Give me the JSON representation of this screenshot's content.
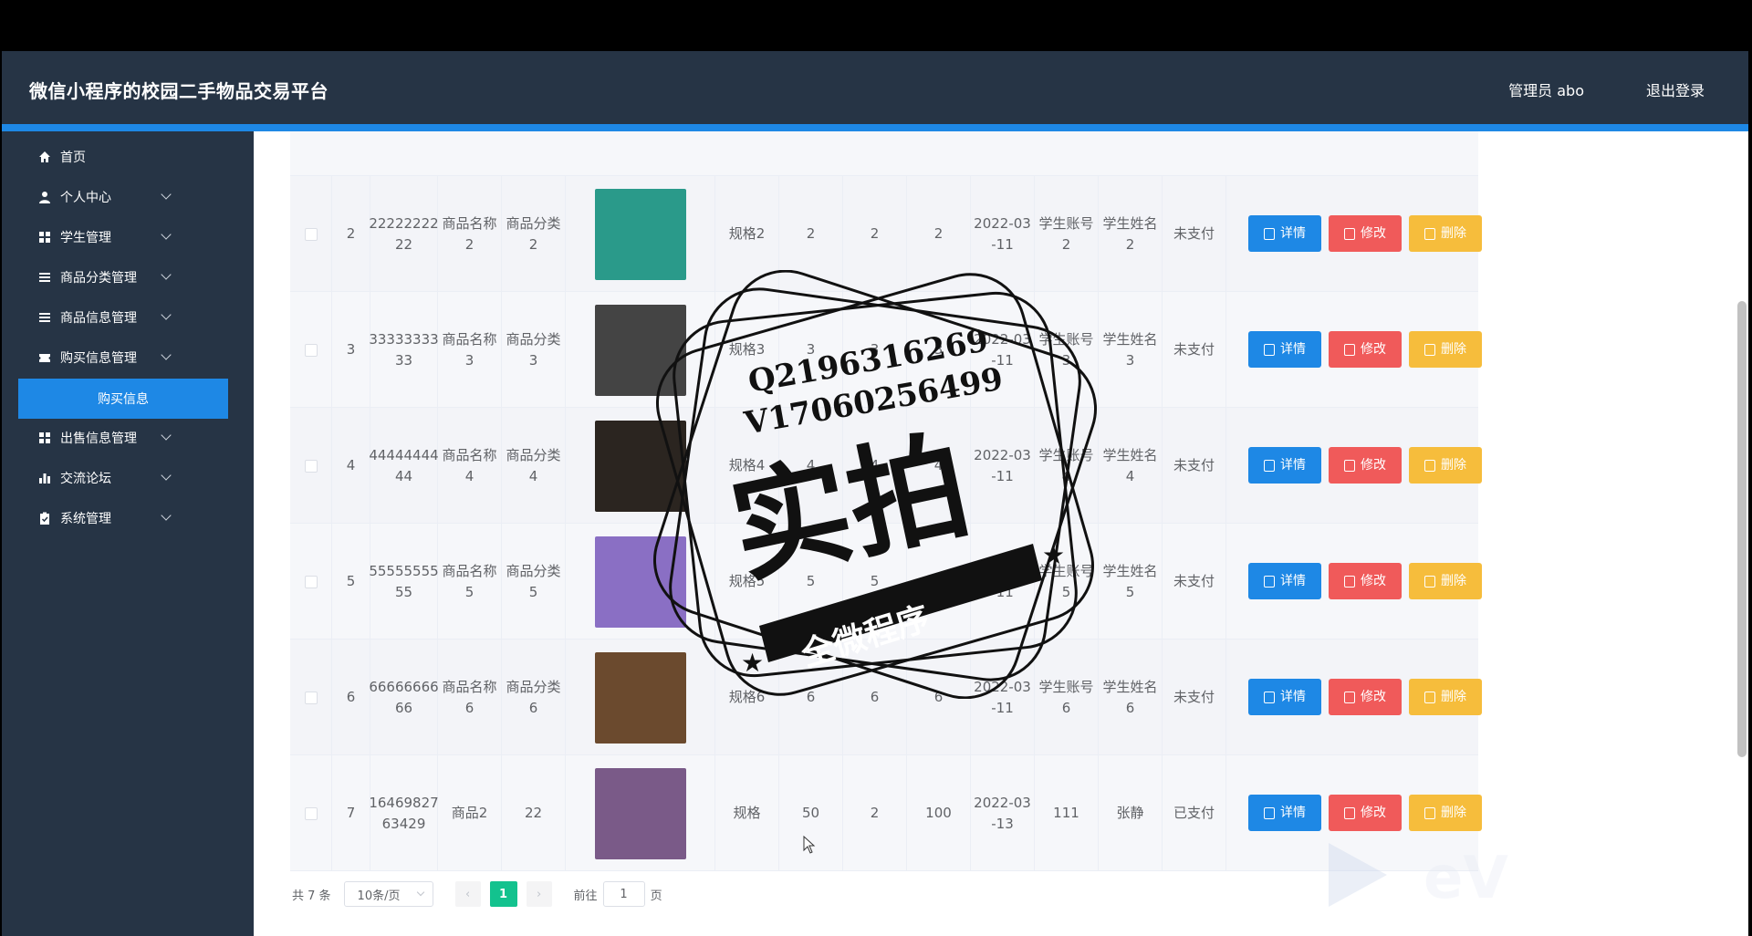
{
  "header": {
    "title": "微信小程序的校园二手物品交易平台",
    "user": "管理员 abo",
    "logout": "退出登录"
  },
  "sidebar": {
    "items": [
      {
        "label": "首页",
        "icon": "home-icon"
      },
      {
        "label": "个人中心",
        "icon": "user-icon"
      },
      {
        "label": "学生管理",
        "icon": "grid-icon"
      },
      {
        "label": "商品分类管理",
        "icon": "list-icon"
      },
      {
        "label": "商品信息管理",
        "icon": "list-icon"
      },
      {
        "label": "购买信息管理",
        "icon": "ticket-icon"
      },
      {
        "label": "出售信息管理",
        "icon": "grid-icon"
      },
      {
        "label": "交流论坛",
        "icon": "chart-icon"
      },
      {
        "label": "系统管理",
        "icon": "clipboard-icon"
      }
    ],
    "active_sub": "购买信息"
  },
  "table": {
    "rows": [
      {
        "index": "2",
        "code": "22222222 22",
        "name": "商品名称 2",
        "category": "商品分类 2",
        "spec": "规格2",
        "price": "2",
        "qty": "2",
        "total": "2",
        "date": "2022-03 -11",
        "account": "学生账号 2",
        "student": "学生姓名 2",
        "status": "未支付",
        "img_color": "#2a9a8a"
      },
      {
        "index": "3",
        "code": "33333333 33",
        "name": "商品名称 3",
        "category": "商品分类 3",
        "spec": "规格3",
        "price": "3",
        "qty": "3",
        "total": "3",
        "date": "2022-03 -11",
        "account": "学生账号 3",
        "student": "学生姓名 3",
        "status": "未支付",
        "img_color": "#444444"
      },
      {
        "index": "4",
        "code": "44444444 44",
        "name": "商品名称 4",
        "category": "商品分类 4",
        "spec": "规格4",
        "price": "4",
        "qty": "4",
        "total": "4",
        "date": "2022-03 -11",
        "account": "学生账号 4",
        "student": "学生姓名 4",
        "status": "未支付",
        "img_color": "#2b2520"
      },
      {
        "index": "5",
        "code": "55555555 55",
        "name": "商品名称 5",
        "category": "商品分类 5",
        "spec": "规格5",
        "price": "5",
        "qty": "5",
        "total": "5",
        "date": "2022-03 -11",
        "account": "学生账号 5",
        "student": "学生姓名 5",
        "status": "未支付",
        "img_color": "#8a6fc4"
      },
      {
        "index": "6",
        "code": "66666666 66",
        "name": "商品名称 6",
        "category": "商品分类 6",
        "spec": "规格6",
        "price": "6",
        "qty": "6",
        "total": "6",
        "date": "2022-03 -11",
        "account": "学生账号 6",
        "student": "学生姓名 6",
        "status": "未支付",
        "img_color": "#6b4a2e"
      },
      {
        "index": "7",
        "code": "16469827 63429",
        "name": "商品2",
        "category": "22",
        "spec": "规格",
        "price": "50",
        "qty": "2",
        "total": "100",
        "date": "2022-03 -13",
        "account": "111",
        "student": "张静",
        "status": "已支付",
        "img_color": "#7a5a88"
      }
    ],
    "actions": {
      "detail": "详情",
      "edit": "修改",
      "delete": "删除"
    }
  },
  "pagination": {
    "total": "共 7 条",
    "page_size": "10条/页",
    "current": "1",
    "goto_prefix": "前往",
    "goto_value": "1",
    "goto_suffix": "页"
  },
  "watermark": {
    "line1": "Q2196316269",
    "line2": "V17060256499",
    "big": "实拍",
    "banner": "全微程序"
  },
  "colors": {
    "header_bg": "#263445",
    "accent_blue": "#1e88e5",
    "edit_red": "#f05a5a",
    "delete_yellow": "#f6bd3c",
    "page_green": "#13c28e"
  }
}
